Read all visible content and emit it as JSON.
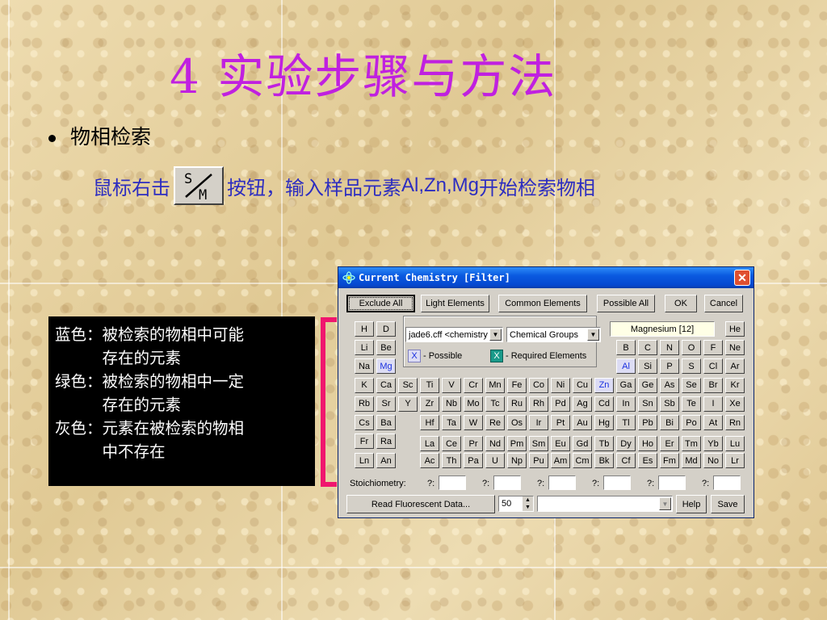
{
  "slide": {
    "title": "4  实验步骤与方法",
    "bullet": "物相检索",
    "instruction_pre": "鼠标右击",
    "instruction_post": "按钮，输入样品元素",
    "instruction_elements": "Al,Zn,Mg",
    "instruction_end": "开始检索物相",
    "sm_button": {
      "top": "S",
      "bottom": "M"
    }
  },
  "legend": {
    "blue_key": "蓝色：",
    "blue_1": "被检索的物相中可能",
    "blue_2": "存在的元素",
    "green_key": "绿色：",
    "green_1": "被检索的物相中一定",
    "green_2": "存在的元素",
    "gray_key": "灰色：",
    "gray_1": "元素在被检索的物相",
    "gray_2": "中不存在"
  },
  "dialog": {
    "title": "Current Chemistry [Filter]",
    "toolbar": {
      "exclude_all": "Exclude All",
      "light_elements": "Light Elements",
      "common_elements": "Common Elements",
      "possible_all": "Possible All",
      "ok": "OK",
      "cancel": "Cancel"
    },
    "database_select": "jade6.cff <chemistry",
    "group_select": "Chemical Groups",
    "element_info": "Magnesium [12]",
    "possible_mark": "X",
    "possible_label": "- Possible",
    "required_mark": "X",
    "required_label": "- Required Elements",
    "stoich_label": "Stoichiometry:",
    "q_label": "?:",
    "read_fluor": "Read Fluorescent Data...",
    "spin_value": "50",
    "help": "Help",
    "save": "Save",
    "colors": {
      "possible": "#1a30e0",
      "required": "#1a9a8a",
      "excluded": "#d4d0c8"
    },
    "rows": [
      [
        "H",
        "D",
        "",
        "",
        "",
        "",
        "",
        "",
        "",
        "",
        "",
        "",
        "",
        "",
        "",
        "",
        "",
        "He"
      ],
      [
        "Li",
        "Be",
        "",
        "",
        "",
        "",
        "",
        "",
        "",
        "",
        "",
        "",
        "B",
        "C",
        "N",
        "O",
        "F",
        "Ne"
      ],
      [
        "Na",
        "Mg",
        "",
        "",
        "",
        "",
        "",
        "",
        "",
        "",
        "",
        "",
        "Al",
        "Si",
        "P",
        "S",
        "Cl",
        "Ar"
      ],
      [
        "K",
        "Ca",
        "Sc",
        "Ti",
        "V",
        "Cr",
        "Mn",
        "Fe",
        "Co",
        "Ni",
        "Cu",
        "Zn",
        "Ga",
        "Ge",
        "As",
        "Se",
        "Br",
        "Kr"
      ],
      [
        "Rb",
        "Sr",
        "Y",
        "Zr",
        "Nb",
        "Mo",
        "Tc",
        "Ru",
        "Rh",
        "Pd",
        "Ag",
        "Cd",
        "In",
        "Sn",
        "Sb",
        "Te",
        "I",
        "Xe"
      ],
      [
        "Cs",
        "Ba",
        "",
        "Hf",
        "Ta",
        "W",
        "Re",
        "Os",
        "Ir",
        "Pt",
        "Au",
        "Hg",
        "Tl",
        "Pb",
        "Bi",
        "Po",
        "At",
        "Rn"
      ],
      [
        "Fr",
        "Ra",
        "",
        "",
        "",
        "",
        "",
        "",
        "",
        "",
        "",
        "",
        "",
        "",
        "",
        "",
        "",
        ""
      ],
      [
        "Ln",
        "An",
        "",
        "Ac",
        "Th",
        "Pa",
        "U",
        "Np",
        "Pu",
        "Am",
        "Cm",
        "Bk",
        "Cf",
        "Es",
        "Fm",
        "Md",
        "No",
        "Lr"
      ]
    ],
    "lanthanides": [
      "La",
      "Ce",
      "Pr",
      "Nd",
      "Pm",
      "Sm",
      "Eu",
      "Gd",
      "Tb",
      "Dy",
      "Ho",
      "Er",
      "Tm",
      "Yb",
      "Lu"
    ],
    "possible_elements": [
      "Mg",
      "Al",
      "Zn"
    ]
  }
}
